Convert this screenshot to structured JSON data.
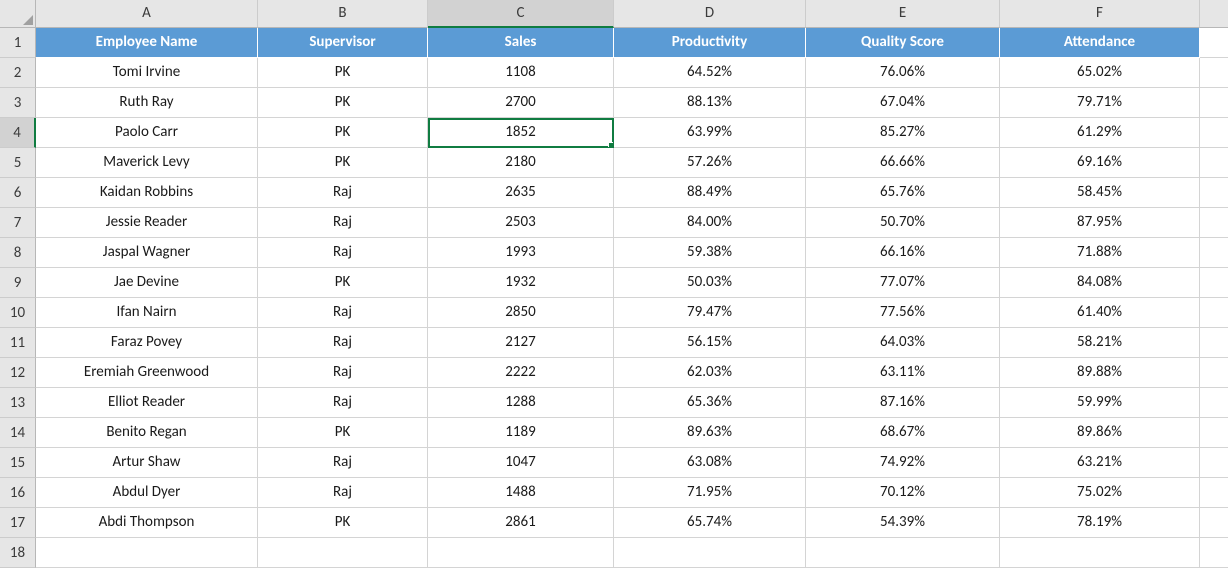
{
  "columns": [
    "A",
    "B",
    "C",
    "D",
    "E",
    "F"
  ],
  "selectedColumn": "C",
  "selectedRow": 4,
  "headers": {
    "A": "Employee Name",
    "B": "Supervisor",
    "C": "Sales",
    "D": "Productivity",
    "E": "Quality Score",
    "F": "Attendance"
  },
  "rows": [
    {
      "n": 2,
      "A": "Tomi Irvine",
      "B": "PK",
      "C": "1108",
      "D": "64.52%",
      "E": "76.06%",
      "F": "65.02%"
    },
    {
      "n": 3,
      "A": "Ruth Ray",
      "B": "PK",
      "C": "2700",
      "D": "88.13%",
      "E": "67.04%",
      "F": "79.71%"
    },
    {
      "n": 4,
      "A": "Paolo Carr",
      "B": "PK",
      "C": "1852",
      "D": "63.99%",
      "E": "85.27%",
      "F": "61.29%"
    },
    {
      "n": 5,
      "A": "Maverick Levy",
      "B": "PK",
      "C": "2180",
      "D": "57.26%",
      "E": "66.66%",
      "F": "69.16%"
    },
    {
      "n": 6,
      "A": "Kaidan Robbins",
      "B": "Raj",
      "C": "2635",
      "D": "88.49%",
      "E": "65.76%",
      "F": "58.45%"
    },
    {
      "n": 7,
      "A": "Jessie Reader",
      "B": "Raj",
      "C": "2503",
      "D": "84.00%",
      "E": "50.70%",
      "F": "87.95%"
    },
    {
      "n": 8,
      "A": "Jaspal Wagner",
      "B": "Raj",
      "C": "1993",
      "D": "59.38%",
      "E": "66.16%",
      "F": "71.88%"
    },
    {
      "n": 9,
      "A": "Jae Devine",
      "B": "PK",
      "C": "1932",
      "D": "50.03%",
      "E": "77.07%",
      "F": "84.08%"
    },
    {
      "n": 10,
      "A": "Ifan Nairn",
      "B": "Raj",
      "C": "2850",
      "D": "79.47%",
      "E": "77.56%",
      "F": "61.40%"
    },
    {
      "n": 11,
      "A": "Faraz Povey",
      "B": "Raj",
      "C": "2127",
      "D": "56.15%",
      "E": "64.03%",
      "F": "58.21%"
    },
    {
      "n": 12,
      "A": "Eremiah Greenwood",
      "B": "Raj",
      "C": "2222",
      "D": "62.03%",
      "E": "63.11%",
      "F": "89.88%"
    },
    {
      "n": 13,
      "A": "Elliot Reader",
      "B": "Raj",
      "C": "1288",
      "D": "65.36%",
      "E": "87.16%",
      "F": "59.99%"
    },
    {
      "n": 14,
      "A": "Benito Regan",
      "B": "PK",
      "C": "1189",
      "D": "89.63%",
      "E": "68.67%",
      "F": "89.86%"
    },
    {
      "n": 15,
      "A": "Artur Shaw",
      "B": "Raj",
      "C": "1047",
      "D": "63.08%",
      "E": "74.92%",
      "F": "63.21%"
    },
    {
      "n": 16,
      "A": "Abdul Dyer",
      "B": "Raj",
      "C": "1488",
      "D": "71.95%",
      "E": "70.12%",
      "F": "75.02%"
    },
    {
      "n": 17,
      "A": "Abdi Thompson",
      "B": "PK",
      "C": "2861",
      "D": "65.74%",
      "E": "54.39%",
      "F": "78.19%"
    }
  ],
  "emptyRow": 18,
  "activeCell": "C4"
}
